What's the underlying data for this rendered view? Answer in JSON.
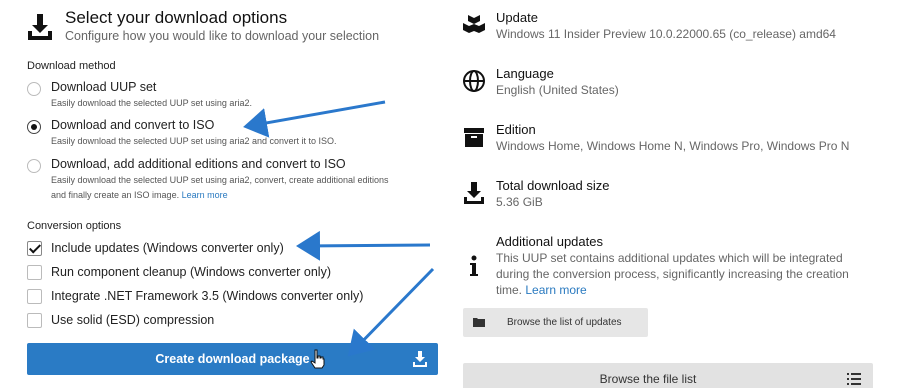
{
  "header": {
    "title": "Select your download options",
    "subtitle": "Configure how you would like to download your selection"
  },
  "download_method": {
    "heading": "Download method",
    "options": [
      {
        "label": "Download UUP set",
        "desc": "Easily download the selected UUP set using aria2.",
        "selected": false
      },
      {
        "label": "Download and convert to ISO",
        "desc": "Easily download the selected UUP set using aria2 and convert it to ISO.",
        "selected": true
      },
      {
        "label": "Download, add additional editions and convert to ISO",
        "desc_line1": "Easily download the selected UUP set using aria2, convert, create additional editions",
        "desc_line2": "and finally create an ISO image.",
        "link": "Learn more",
        "selected": false
      }
    ]
  },
  "conversion_options": {
    "heading": "Conversion options",
    "items": [
      {
        "label": "Include updates (Windows converter only)",
        "checked": true
      },
      {
        "label": "Run component cleanup (Windows converter only)",
        "checked": false
      },
      {
        "label": "Integrate .NET Framework 3.5 (Windows converter only)",
        "checked": false
      },
      {
        "label": "Use solid (ESD) compression",
        "checked": false
      }
    ]
  },
  "create_button": "Create download package",
  "info": {
    "update": {
      "title": "Update",
      "value": "Windows 11 Insider Preview 10.0.22000.65 (co_release) amd64"
    },
    "language": {
      "title": "Language",
      "value": "English (United States)"
    },
    "edition": {
      "title": "Edition",
      "value": "Windows Home, Windows Home N, Windows Pro, Windows Pro N"
    },
    "size": {
      "title": "Total download size",
      "value": "5.36 GiB"
    },
    "additional": {
      "title": "Additional updates",
      "line1": "This UUP set contains additional updates which will be integrated",
      "line2": "during the conversion process, significantly increasing the creation",
      "line3": "time.",
      "link": "Learn more"
    }
  },
  "browse_updates_button": "Browse the list of updates",
  "browse_files_button": "Browse the file list",
  "colors": {
    "accent": "#2a7bc5",
    "annotation_arrow": "#2a78cc"
  },
  "icons": [
    "download-icon",
    "package-icon",
    "globe-icon",
    "archive-icon",
    "info-icon",
    "folder-icon",
    "list-icon",
    "hand-cursor-icon"
  ]
}
